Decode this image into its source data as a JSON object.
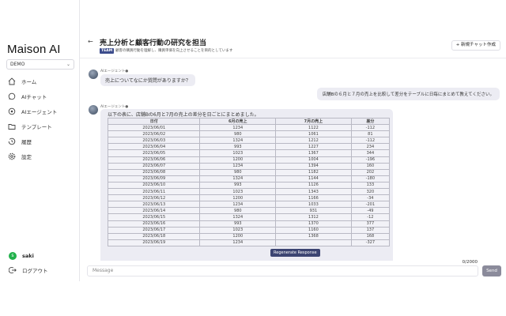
{
  "sidebar": {
    "brand": "Maison AI",
    "workspace": "DEMO",
    "items": [
      {
        "label": "ホーム",
        "icon": "home-icon"
      },
      {
        "label": "AIチャット",
        "icon": "chat-icon"
      },
      {
        "label": "AIエージェント",
        "icon": "agent-icon"
      },
      {
        "label": "テンプレート",
        "icon": "folder-icon"
      },
      {
        "label": "履歴",
        "icon": "history-icon"
      },
      {
        "label": "設定",
        "icon": "gear-icon"
      }
    ],
    "user": {
      "initial": "s",
      "name": "saki"
    },
    "logout": "ログアウト"
  },
  "header": {
    "back": "←",
    "title": "売上分析と顧客行動の研究を担当",
    "badge": "TEAM",
    "subtitle": "顧客の購買行動を理解し、購買単価を向上させることを目的としています",
    "new_chat": "+ 新規チャット作成"
  },
  "chat": {
    "ai_name": "AIエージェント●",
    "greeting": "売上についてなにか質問がありますか？",
    "user_message": "店舗Bの６月と７月の売上を比較して差分をテーブルに日毎にまとめて教えてください。",
    "answer_intro": "以下の表に、店舗Bの6月と7月の売上の差分を日ごとにまとめました。",
    "table": {
      "headers": [
        "日付",
        "6月の売上",
        "7月の売上",
        "差分"
      ],
      "rows": [
        [
          "2023/06/01",
          "1234",
          "1122",
          "-112"
        ],
        [
          "2023/06/02",
          "980",
          "1061",
          "81"
        ],
        [
          "2023/06/03",
          "1324",
          "1212",
          "-112"
        ],
        [
          "2023/06/04",
          "993",
          "1227",
          "234"
        ],
        [
          "2023/06/05",
          "1023",
          "1367",
          "344"
        ],
        [
          "2023/06/06",
          "1200",
          "1004",
          "-196"
        ],
        [
          "2023/06/07",
          "1234",
          "1394",
          "160"
        ],
        [
          "2023/06/08",
          "980",
          "1182",
          "202"
        ],
        [
          "2023/06/09",
          "1324",
          "1144",
          "-180"
        ],
        [
          "2023/06/10",
          "993",
          "1126",
          "133"
        ],
        [
          "2023/06/11",
          "1023",
          "1343",
          "320"
        ],
        [
          "2023/06/12",
          "1200",
          "1166",
          "-34"
        ],
        [
          "2023/06/13",
          "1234",
          "1033",
          "-201"
        ],
        [
          "2023/06/14",
          "980",
          "931",
          "-49"
        ],
        [
          "2023/06/15",
          "1324",
          "1312",
          "-12"
        ],
        [
          "2023/06/16",
          "993",
          "1370",
          "377"
        ],
        [
          "2023/06/17",
          "1023",
          "1160",
          "137"
        ],
        [
          "2023/06/18",
          "1200",
          "1368",
          "168"
        ],
        [
          "2023/06/19",
          "1234",
          "",
          "-327"
        ]
      ]
    },
    "regenerate": "Regenerate Response"
  },
  "composer": {
    "counter": "0/2000",
    "placeholder": "Message",
    "send": "Send"
  }
}
